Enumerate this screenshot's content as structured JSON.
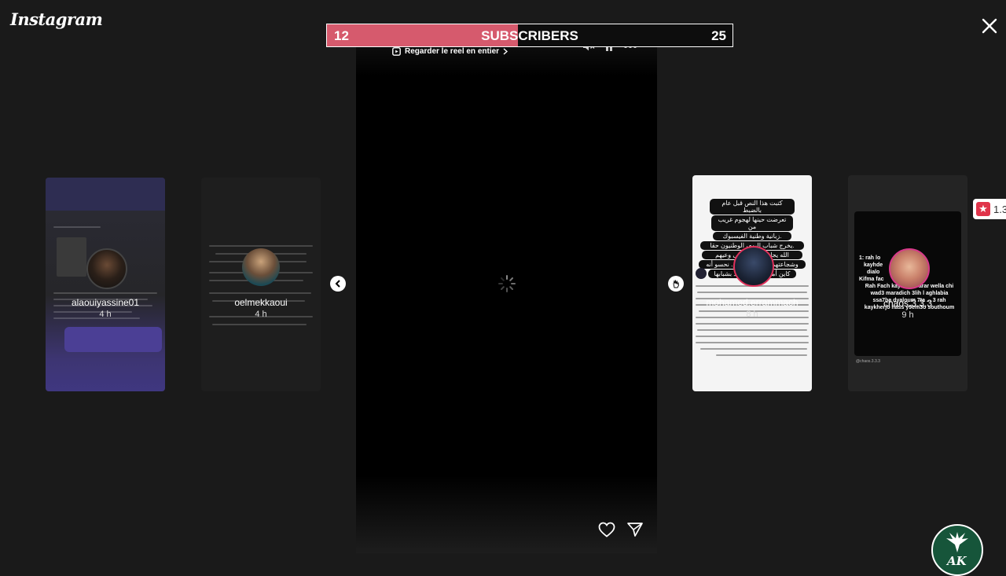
{
  "app": {
    "logo_text": "Instagram"
  },
  "subscriber_bar": {
    "left_count": "12",
    "label": "SUBSCRIBERS",
    "right_count": "25",
    "fill_fraction": 0.47,
    "fill_color": "#d65a6d"
  },
  "story": {
    "watch_full_label": "Regarder le reel en entier",
    "icons": [
      "volume-icon",
      "pause-icon",
      "more-icon",
      "loading-spinner-icon",
      "heart-icon",
      "send-icon"
    ]
  },
  "side_stories": [
    {
      "username": "alaouiyassine01",
      "time": "4 h"
    },
    {
      "username": "oelmekkaoui",
      "time": "4 h"
    },
    {
      "username": "mohamed.errammach",
      "time": "8 h"
    },
    {
      "username": "chaos.3.3.3",
      "time": "9 h"
    }
  ],
  "card_texts": {
    "mohamed_bubbles": [
      "كتبت هذا النص قبل عام بالضبط",
      "تعرضت حينها لهجوم غريب من",
      "زبانية وطنية الفيسبوك.",
      "يخرج شباب اليوم، الوطنيون حقا.",
      "الله يجازيهم بخير على وعيهم",
      "وشجاعتهم وحبهم لوطنهم. نحسو أنه",
      "كاين أمل في هاد البلاد بشبابها"
    ],
    "chaos_text": [
      "1: rah lo",
      "kayhde",
      "dialo",
      "Kifma fac",
      "Rah Fach kaykoun Farar wella chi",
      "wad3 maradich 3lih l aghlabia",
      "ssa7ba dyaloum 7ta ... 3 rah",
      "kaykherjo nass y9em3o southoum"
    ],
    "chaos_handle": "@chaos.3.3.3"
  },
  "badge": {
    "text": "1.3"
  },
  "corner_logo": {
    "text": "AK"
  }
}
